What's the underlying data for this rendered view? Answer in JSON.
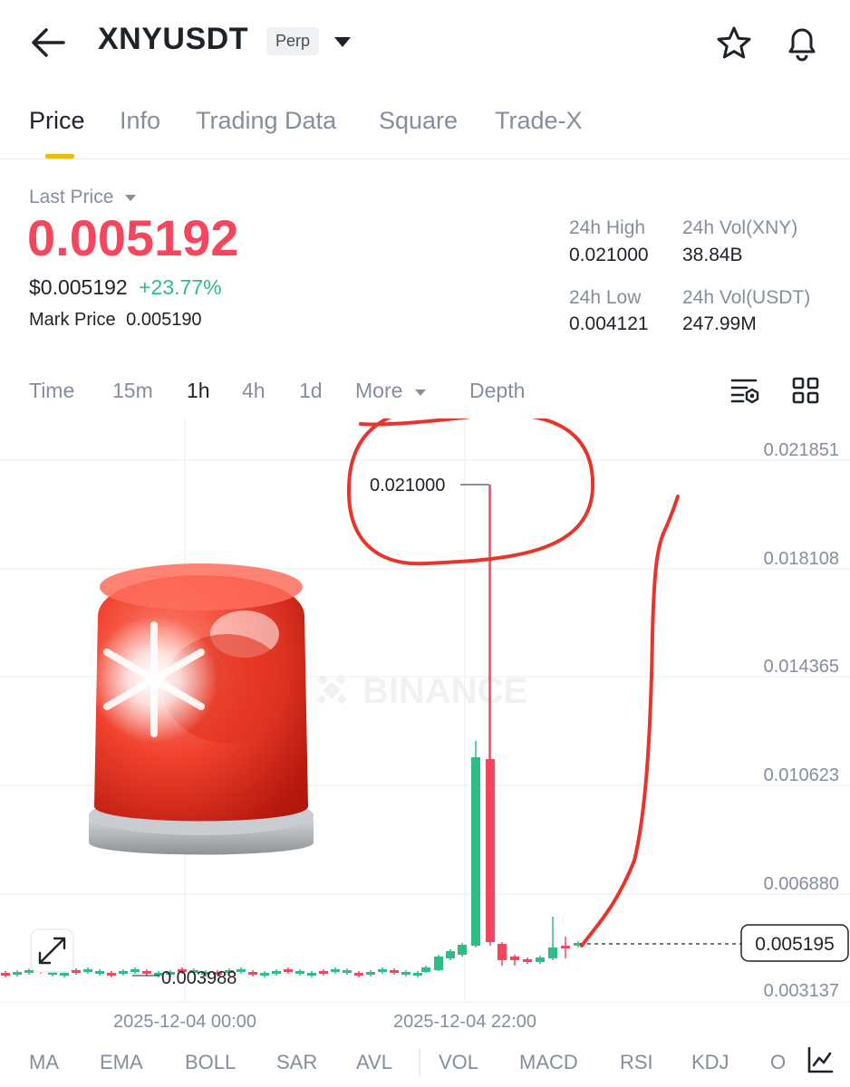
{
  "header": {
    "title": "XNYUSDT",
    "badge": "Perp"
  },
  "tabs": [
    "Price",
    "Info",
    "Trading Data",
    "Square",
    "Trade-X"
  ],
  "price": {
    "last_price_label": "Last Price",
    "last_price": "0.005192",
    "usd_price": "$0.005192",
    "change": "+23.77%",
    "mark_price_label": "Mark Price",
    "mark_price": "0.005190"
  },
  "stats": {
    "high_label": "24h High",
    "high": "0.021000",
    "vol_xny_label": "24h Vol(XNY)",
    "vol_xny": "38.84B",
    "low_label": "24h Low",
    "low": "0.004121",
    "vol_usdt_label": "24h Vol(USDT)",
    "vol_usdt": "247.99M"
  },
  "intervals": [
    "Time",
    "15m",
    "1h",
    "4h",
    "1d",
    "More",
    "Depth"
  ],
  "watermark": "BINANCE",
  "chart_data": {
    "type": "candlestick",
    "y_ticks": [
      "0.021851",
      "0.018108",
      "0.014365",
      "0.010623",
      "0.006880",
      "0.003137"
    ],
    "x_ticks": [
      "2025-12-04 00:00",
      "2025-12-04 22:00"
    ],
    "high_label": "0.021000",
    "low_label": "0.003988",
    "current_price": "0.005195",
    "ylim": [
      0.003137,
      0.021851
    ]
  },
  "indicators": [
    "MA",
    "EMA",
    "BOLL",
    "SAR",
    "AVL",
    "VOL",
    "MACD",
    "RSI",
    "KDJ",
    "O"
  ],
  "colors": {
    "up": "#2ebd85",
    "down": "#f6465d",
    "accent": "#f0b90b",
    "annotation": "#e8342a"
  }
}
